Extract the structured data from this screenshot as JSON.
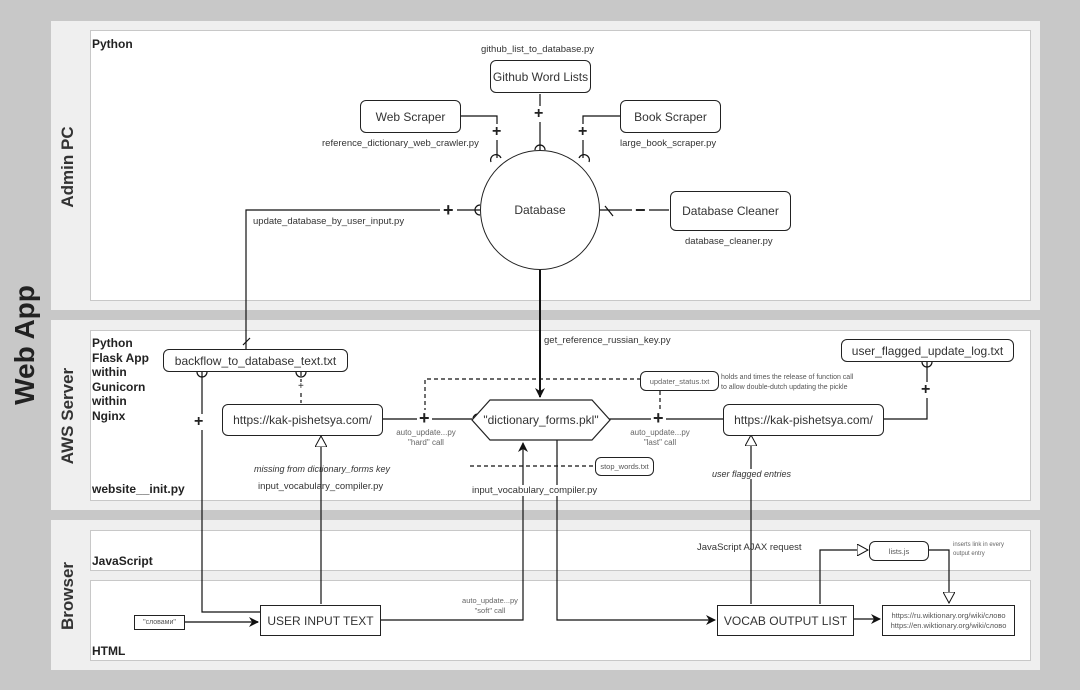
{
  "outer_label": "Web App",
  "sections": {
    "admin": {
      "label": "Admin PC",
      "lang": "Python"
    },
    "server": {
      "label": "AWS Server",
      "lang": "Python\nFlask App\nwithin\nGunicorn\nwithin\nNginx",
      "footer": "website__init.py"
    },
    "browser": {
      "label": "Browser",
      "js_lang": "JavaScript",
      "html_lang": "HTML"
    }
  },
  "admin_nodes": {
    "github": {
      "label": "Github Word Lists",
      "caption": "github_list_to_database.py"
    },
    "web_scraper": {
      "label": "Web Scraper",
      "caption": "reference_dictionary_web_crawler.py"
    },
    "book_scraper": {
      "label": "Book Scraper",
      "caption": "large_book_scraper.py"
    },
    "database": {
      "label": "Database"
    },
    "cleaner": {
      "label": "Database Cleaner",
      "caption": "database_cleaner.py"
    },
    "update_by_user": {
      "caption": "update_database_by_user_input.py"
    }
  },
  "server_nodes": {
    "backflow": {
      "label": "backflow_to_database_text.txt"
    },
    "site_left": {
      "label": "https://kak-pishetsya.com/"
    },
    "dict_forms": {
      "label": "\"dictionary_forms.pkl\""
    },
    "site_right": {
      "label": "https://kak-pishetsya.com/"
    },
    "user_log": {
      "label": "user_flagged_update_log.txt"
    },
    "updater_status": {
      "label": "updater_status.txt",
      "note": "holds and times the release of function call\nto allow double-dutch updating the pickle"
    },
    "stop_words": {
      "label": "stop_words.txt"
    },
    "get_key_caption": "get_reference_russian_key.py",
    "hard_call": "auto_update...py\n\"hard\" call",
    "last_call": "auto_update...py\n\"last\" call",
    "missing_note": "missing from dictionary_forms key",
    "compiler_left": "input_vocabulary_compiler.py",
    "compiler_center": "input_vocabulary_compiler.py",
    "flagged_note": "user flagged entries"
  },
  "browser_nodes": {
    "input_sample": {
      "label": "\"словами\""
    },
    "user_input": {
      "label": "USER INPUT TEXT"
    },
    "soft_call": "auto_update...py\n\"soft\" call",
    "ajax_caption": "JavaScript AJAX request",
    "lists_js": {
      "label": "lists.js",
      "note": "inserts link in every\noutput entry"
    },
    "vocab_output": {
      "label": "VOCAB OUTPUT LIST"
    },
    "wiktionary": {
      "lines": [
        "https://ru.wiktionary.org/wiki/слово",
        "https://en.wiktionary.org/wiki/слово"
      ]
    }
  },
  "connector_symbols": {
    "plus": "+",
    "minus": "−"
  }
}
